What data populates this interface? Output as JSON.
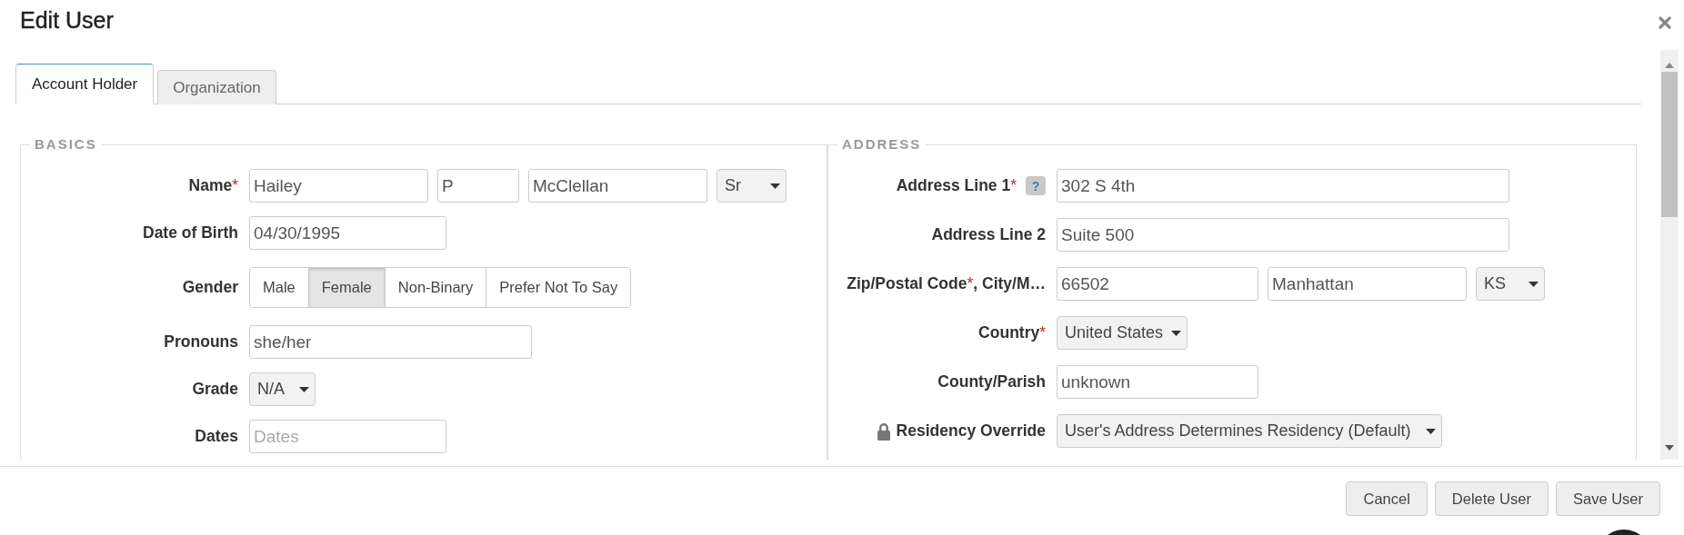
{
  "dialog": {
    "title": "Edit User"
  },
  "tabs": [
    {
      "label": "Account Holder",
      "selected": true
    },
    {
      "label": "Organization",
      "selected": false
    }
  ],
  "sections": [
    {
      "legend": "BASICS",
      "fields": [
        {
          "label": "Name",
          "mark": "*",
          "controls": [
            {
              "kind": "input",
              "value": "Hailey"
            },
            {
              "kind": "input",
              "value": "P"
            },
            {
              "kind": "input",
              "value": "McClellan"
            },
            {
              "kind": "select",
              "value": "Sr"
            }
          ]
        },
        {
          "label": "Date of Birth",
          "controls": [
            {
              "kind": "input",
              "value": "04/30/1995"
            }
          ]
        },
        {
          "label": "Gender",
          "controls": [
            {
              "kind": "segmented",
              "options": [
                {
                  "label": "Male",
                  "selected": false
                },
                {
                  "label": "Female",
                  "selected": true
                },
                {
                  "label": "Non-Binary",
                  "selected": false
                },
                {
                  "label": "Prefer Not To Say",
                  "selected": false
                }
              ]
            }
          ]
        },
        {
          "label": "Pronouns",
          "controls": [
            {
              "kind": "input",
              "value": "she/her"
            }
          ]
        },
        {
          "label": "Grade",
          "controls": [
            {
              "kind": "select",
              "value": "N/A"
            }
          ]
        },
        {
          "label": "Dates",
          "controls": [
            {
              "kind": "input",
              "placeholder": "Dates"
            }
          ]
        }
      ]
    },
    {
      "legend": "ADDRESS",
      "fields": [
        {
          "label": "Address Line 1",
          "mark": "*",
          "help": "?",
          "controls": [
            {
              "kind": "input",
              "value": "302 S 4th"
            }
          ]
        },
        {
          "label": "Address Line 2",
          "controls": [
            {
              "kind": "input",
              "value": "Suite 500"
            }
          ]
        },
        {
          "label": "Zip/Postal Code",
          "mark": "*",
          "label_rest": ", City/M…",
          "controls": [
            {
              "kind": "input",
              "value": "66502"
            },
            {
              "kind": "input",
              "value": "Manhattan"
            },
            {
              "kind": "select",
              "value": "KS"
            }
          ]
        },
        {
          "label": "Country",
          "mark": "*",
          "controls": [
            {
              "kind": "select",
              "value": "United States"
            }
          ]
        },
        {
          "label": "County/Parish",
          "controls": [
            {
              "kind": "input",
              "value": "unknown"
            }
          ]
        },
        {
          "label": "Residency Override",
          "locked": true,
          "controls": [
            {
              "kind": "select",
              "value": "User's Address Determines Residency (Default)"
            }
          ]
        }
      ]
    }
  ],
  "buttons": [
    "Cancel",
    "Delete User",
    "Save User"
  ]
}
